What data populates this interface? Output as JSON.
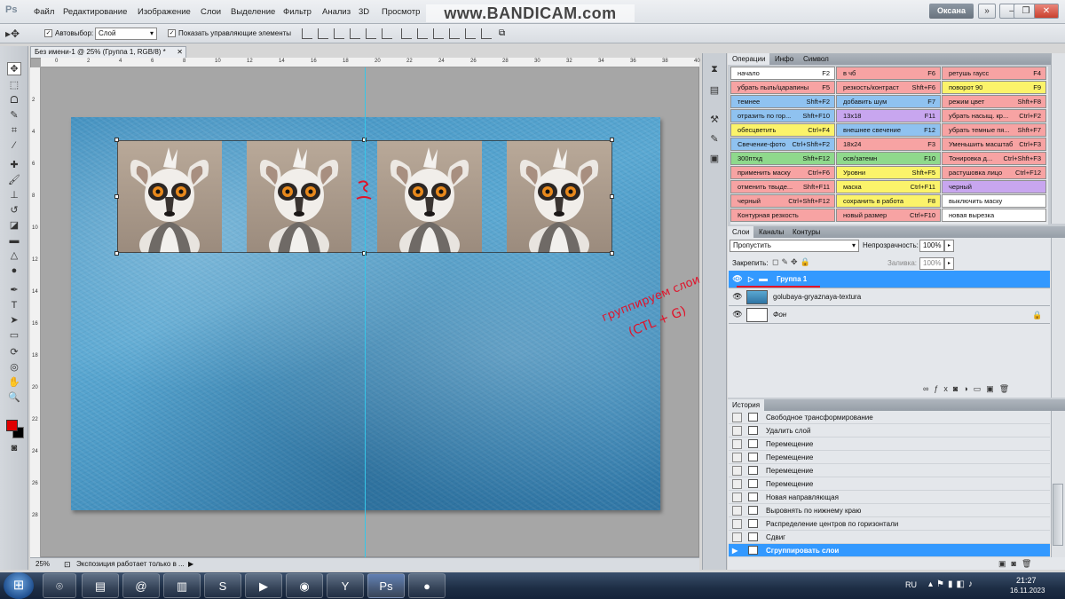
{
  "app": {
    "logo": "Ps"
  },
  "menu": [
    "Файл",
    "Редактирование",
    "Изображение",
    "Слои",
    "Выделение",
    "Фильтр",
    "Анализ",
    "3D",
    "Просмотр"
  ],
  "watermark": "www.BANDICAM.com",
  "workspace": "Оксана",
  "options": {
    "autoselect_label": "Автовыбор:",
    "autoselect_value": "Слой",
    "show_controls_label": "Показать управляющие элементы"
  },
  "document": {
    "tab_title": "Без имени-1 @ 25% (Группа 1, RGB/8) *",
    "zoom": "25%",
    "status": "Экспозиция работает только в ...",
    "ruler_top": [
      "0",
      "2",
      "4",
      "6",
      "8",
      "10",
      "12",
      "14",
      "16",
      "18",
      "20",
      "22",
      "24",
      "26",
      "28",
      "30",
      "32",
      "34",
      "36",
      "38",
      "40"
    ],
    "ruler_left": [
      "2",
      "4",
      "6",
      "8",
      "10",
      "12",
      "14",
      "16",
      "18",
      "20",
      "22",
      "24",
      "26",
      "28"
    ]
  },
  "annotation": {
    "line1": "группируем слои",
    "line2": "(CTL + G)"
  },
  "actions_panel": {
    "tabs": [
      "Операции",
      "Инфо",
      "Символ"
    ],
    "rows": [
      [
        {
          "label": "начало",
          "key": "F2",
          "color": "#ffffff"
        },
        {
          "label": "в чб",
          "key": "F6",
          "color": "#f7a3a3"
        },
        {
          "label": "ретушь гаусс",
          "key": "F4",
          "color": "#f7a3a3"
        }
      ],
      [
        {
          "label": "убрать пыль/царапины",
          "key": "F5",
          "color": "#f7a3a3"
        },
        {
          "label": "резкость/контраст",
          "key": "Shft+F6",
          "color": "#f7a3a3"
        },
        {
          "label": "поворот 90",
          "key": "F9",
          "color": "#fbf36a"
        }
      ],
      [
        {
          "label": "темнее",
          "key": "Shft+F2",
          "color": "#8fc2f0"
        },
        {
          "label": "добавить шум",
          "key": "F7",
          "color": "#8fc2f0"
        },
        {
          "label": "режим цвет",
          "key": "Shft+F8",
          "color": "#f7a3a3"
        }
      ],
      [
        {
          "label": "отразить по гор...",
          "key": "Shft+F10",
          "color": "#8fc2f0"
        },
        {
          "label": "13x18",
          "key": "F11",
          "color": "#c8a6ef"
        },
        {
          "label": "убрать насыщ. кр...",
          "key": "Ctrl+F2",
          "color": "#f7a3a3"
        }
      ],
      [
        {
          "label": "обесцветить",
          "key": "Ctrl+F4",
          "color": "#fbf36a"
        },
        {
          "label": "внешнее свечение",
          "key": "F12",
          "color": "#8fc2f0"
        },
        {
          "label": "убрать темные пя...",
          "key": "Shft+F7",
          "color": "#f7a3a3"
        }
      ],
      [
        {
          "label": "Свечение-фото",
          "key": "Ctrl+Shft+F2",
          "color": "#8fc2f0"
        },
        {
          "label": "18x24",
          "key": "F3",
          "color": "#f7a3a3"
        },
        {
          "label": "Уменьшить масштаб",
          "key": "Ctrl+F3",
          "color": "#f7a3a3"
        }
      ],
      [
        {
          "label": "300птхд",
          "key": "Shft+F12",
          "color": "#8fd98c"
        },
        {
          "label": "осв/затемн",
          "key": "F10",
          "color": "#8fd98c"
        },
        {
          "label": "Тонировка д...",
          "key": "Ctrl+Shft+F3",
          "color": "#f7a3a3"
        }
      ],
      [
        {
          "label": "применить маску",
          "key": "Ctrl+F6",
          "color": "#f7a3a3"
        },
        {
          "label": "Уровни",
          "key": "Shft+F5",
          "color": "#fbf36a"
        },
        {
          "label": "растушовка лицо",
          "key": "Ctrl+F12",
          "color": "#f7a3a3"
        }
      ],
      [
        {
          "label": "отменить твыде...",
          "key": "Shft+F11",
          "color": "#f7a3a3"
        },
        {
          "label": "маска",
          "key": "Ctrl+F11",
          "color": "#fbf36a"
        },
        {
          "label": "черный",
          "key": "",
          "color": "#c8a6ef"
        }
      ],
      [
        {
          "label": "черный",
          "key": "Ctrl+Shft+F12",
          "color": "#f7a3a3"
        },
        {
          "label": "сохранить в работа",
          "key": "F8",
          "color": "#fbf36a"
        },
        {
          "label": "выключить маску",
          "key": "",
          "color": "#ffffff"
        }
      ],
      [
        {
          "label": "Контурная резкость",
          "key": "",
          "color": "#f7a3a3"
        },
        {
          "label": "новый размер",
          "key": "Ctrl+F10",
          "color": "#f7a3a3"
        },
        {
          "label": "новая вырезка",
          "key": "",
          "color": "#ffffff"
        }
      ]
    ]
  },
  "layers_panel": {
    "tabs": [
      "Слои",
      "Каналы",
      "Контуры"
    ],
    "blend_mode": "Пропустить",
    "opacity_label": "Непрозрачность:",
    "opacity": "100%",
    "lock_label": "Закрепить:",
    "fill_label": "Заливка:",
    "fill": "100%",
    "layers": [
      {
        "name": "Группа 1",
        "selected": true
      },
      {
        "name": "golubaya-gryaznaya-textura",
        "selected": false
      },
      {
        "name": "Фон",
        "selected": false
      }
    ]
  },
  "history_panel": {
    "tab": "История",
    "items": [
      "Свободное трансформирование",
      "Удалить слой",
      "Перемещение",
      "Перемещение",
      "Перемещение",
      "Перемещение",
      "Новая направляющая",
      "Выровнять по нижнему краю",
      "Распределение центров по горизонтали",
      "Сдвиг",
      "Сгруппировать слои"
    ]
  },
  "tray": {
    "lang": "RU",
    "time": "21:27",
    "date": "16.11.2023"
  },
  "colors": {
    "accent": "#3399ff",
    "foreground": "#e00000",
    "background_swatch": "#000000"
  }
}
